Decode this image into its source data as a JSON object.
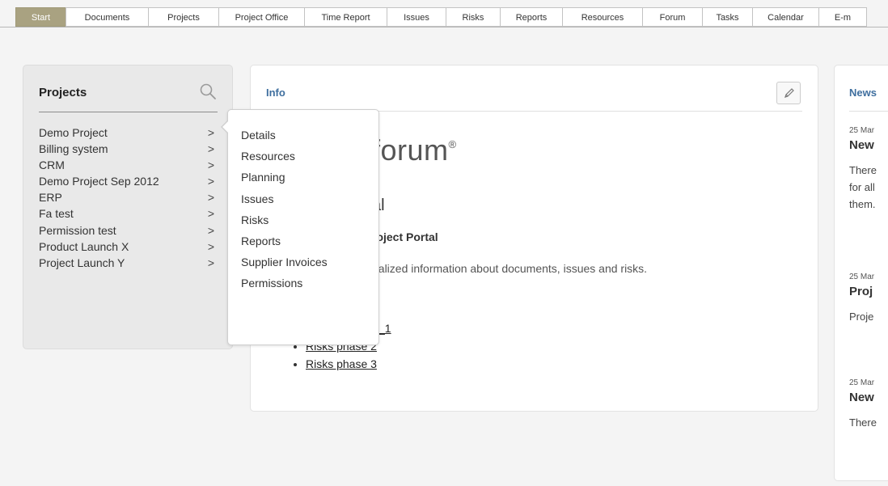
{
  "tabs": [
    {
      "label": "Start",
      "active": true
    },
    {
      "label": "Documents"
    },
    {
      "label": "Projects"
    },
    {
      "label": "Project Office"
    },
    {
      "label": "Time Report"
    },
    {
      "label": "Issues"
    },
    {
      "label": "Risks"
    },
    {
      "label": "Reports"
    },
    {
      "label": "Resources"
    },
    {
      "label": "Forum"
    },
    {
      "label": "Tasks"
    },
    {
      "label": "Calendar"
    },
    {
      "label": "E-m"
    }
  ],
  "projects": {
    "title": "Projects",
    "search_icon": "search-icon",
    "chevron_glyph": ">",
    "items": [
      "Demo Project",
      "Billing system",
      "CRM",
      "Demo Project Sep 2012",
      "ERP",
      "Fa test",
      "Permission test",
      "Product Launch X",
      "Project Launch Y"
    ]
  },
  "popup_menu": {
    "items": [
      "Details",
      "Resources",
      "Planning",
      "Issues",
      "Risks",
      "Reports",
      "Supplier Invoices",
      "Permissions"
    ]
  },
  "info": {
    "title": "Info",
    "edit_icon": "pencil-icon",
    "logo_text": "forum",
    "logo_mark": "®",
    "heading_visible": "al",
    "subheading_visible": "roject Portal",
    "description_visible": "nalized information about documents, issues and risks.",
    "links": [
      "_1",
      "Risks phase 2",
      "Risks phase 3"
    ]
  },
  "news": {
    "title": "News",
    "items": [
      {
        "date": "25 Mar",
        "headline": "New",
        "body": [
          "There",
          "for all",
          "them."
        ]
      },
      {
        "date": "25 Mar",
        "headline": "Proj",
        "body": [
          "Proje"
        ]
      },
      {
        "date": "25 Mar",
        "headline": "New",
        "body": [
          "There"
        ]
      }
    ]
  },
  "colors": {
    "active_tab": "#a9a281",
    "panel_title": "#3f6f9f",
    "projects_panel_bg": "#e9e9e9"
  }
}
